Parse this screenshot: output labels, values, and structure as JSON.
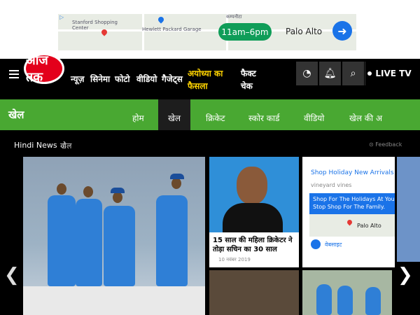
{
  "ad_top": {
    "hours": "11am–6pm",
    "place": "Palo Alto",
    "map_labels": [
      "Stanford Shopping Center",
      "Hewlett Packard Garage",
      "कम्पनीटा"
    ]
  },
  "header": {
    "logo_text": "आज तक",
    "nav_items": [
      "न्यूज़",
      "सिनेमा",
      "फोटो",
      "वीडियो",
      "गैजेट्स"
    ],
    "highlight_item_line1": "अयोध्या का",
    "highlight_item_line2": "फैसला",
    "factcheck_line1": "फैक्ट",
    "factcheck_line2": "चेक",
    "live_label": "LIVE TV"
  },
  "section": {
    "title": "खेल",
    "tabs": [
      "होम",
      "खेल",
      "क्रिकेट",
      "स्कोर कार्ड",
      "वीडियो",
      "खेल की अ"
    ],
    "active_tab": "खेल"
  },
  "breadcrumb": {
    "root": "Hindi News",
    "separator": "/",
    "current": "खेल",
    "feedback": "Feedback"
  },
  "cards": [
    {
      "title": "15 साल की महिला क्रिकेटर ने तोड़ा सचिन का 30 साल",
      "date": "10 नवंबर 2019"
    }
  ],
  "ad_side": {
    "title": "Shop Holiday New Arrivals",
    "subtitle": "vineyard vines",
    "body": "Shop For The Holidays At Your Stop Shop For The Family.",
    "place": "Palo Alto",
    "footer": "वेबसाइट"
  },
  "colors": {
    "section_green": "#49a832",
    "brand_red": "#e3001b",
    "highlight_yellow": "#ffd400"
  }
}
